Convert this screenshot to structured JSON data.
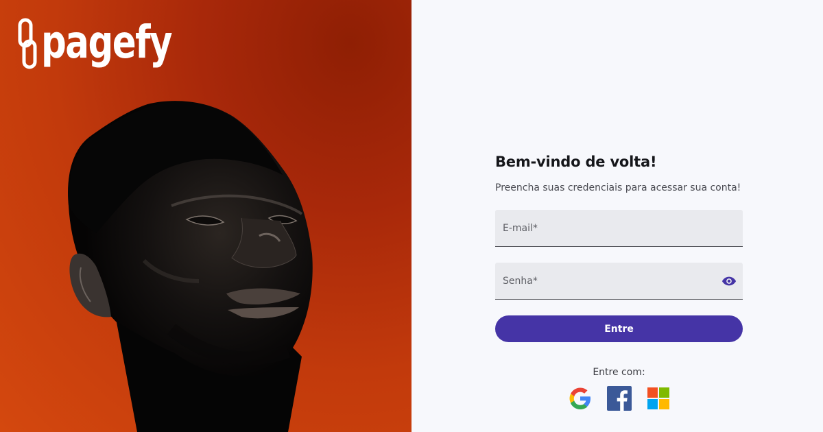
{
  "brand": {
    "name": "pagefy"
  },
  "login": {
    "title": "Bem-vindo de volta!",
    "subtitle": "Preencha suas credenciais para acessar sua conta!",
    "email_placeholder": "E-mail*",
    "password_placeholder": "Senha*",
    "submit_label": "Entre",
    "social_label": "Entre com:"
  },
  "social_providers": [
    "google-icon",
    "facebook-icon",
    "microsoft-icon"
  ],
  "colors": {
    "primary": "#4534a6",
    "hero_background": "#c23a0c",
    "panel_background": "#f7f8fc",
    "facebook": "#3b5998"
  }
}
